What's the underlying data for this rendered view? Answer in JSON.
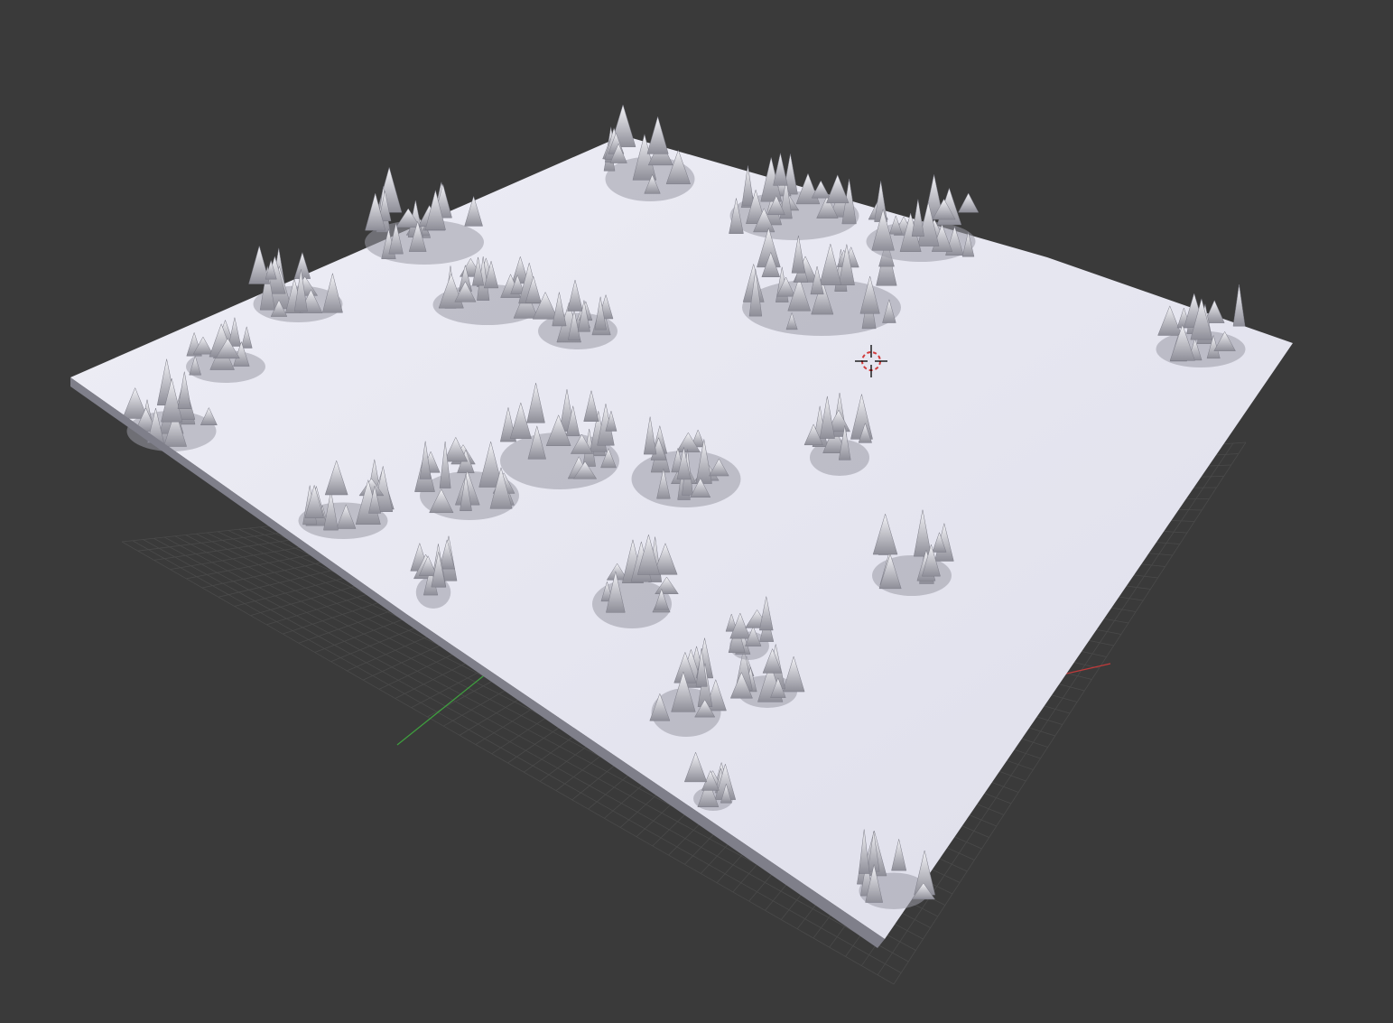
{
  "viewport": {
    "background_color": "#3a3a3a",
    "grid_color": "#4a4a4a",
    "x_axis_color": "#c03a3a",
    "y_axis_color": "#3fa03f",
    "mesh_color": "#e6e6f0",
    "mesh_shade_color": "#9a9aa6",
    "mesh_edge_color": "#7d7d88",
    "cursor_colors": [
      "#000000",
      "#d23c3c"
    ]
  },
  "scene": {
    "object": "terrain-mesh",
    "overlay_grid": "floor-grid",
    "cursor": "3d-cursor-icon"
  }
}
